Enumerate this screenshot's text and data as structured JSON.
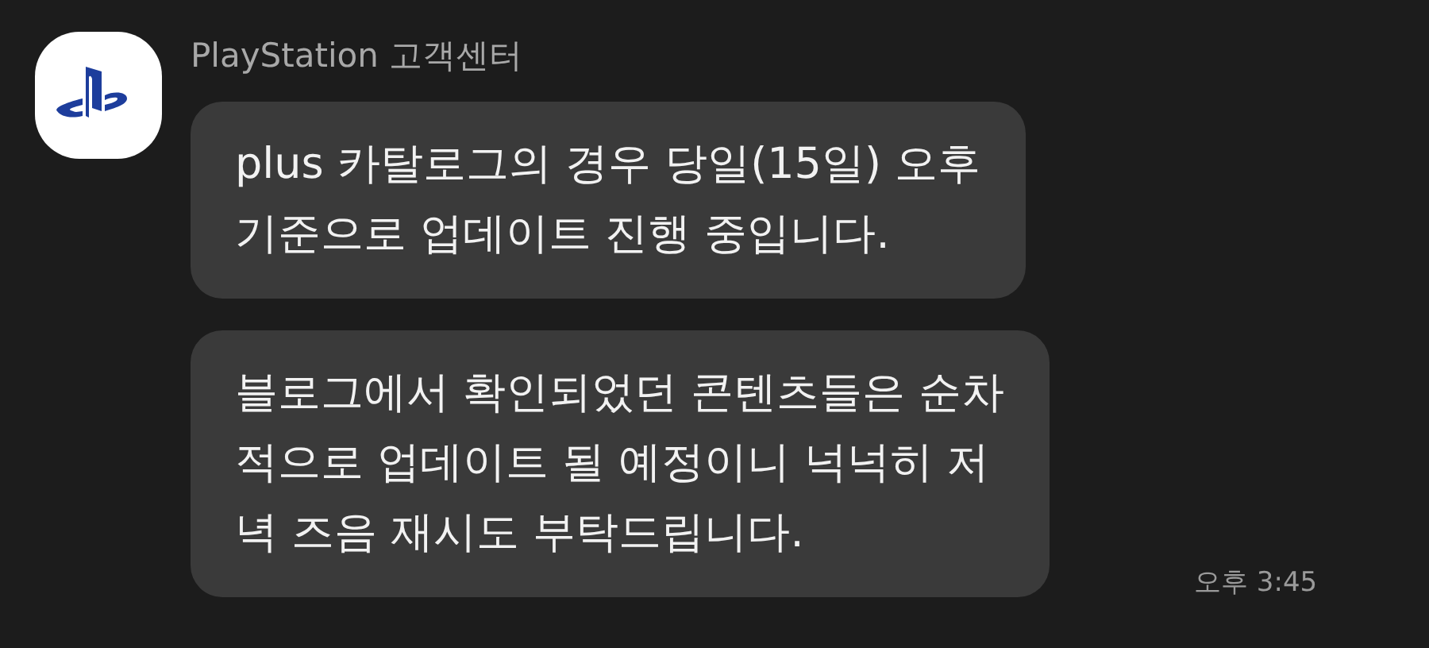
{
  "sender": {
    "name": "PlayStation 고객센터"
  },
  "messages": [
    {
      "text": "plus 카탈로그의 경우 당일(15일) 오후\n기준으로 업데이트 진행 중입니다."
    },
    {
      "text": "블로그에서 확인되었던 콘텐츠들은 순차\n적으로 업데이트 될 예정이니 넉넉히 저\n녁 즈음 재시도 부탁드립니다."
    }
  ],
  "time": "오후 3:45"
}
